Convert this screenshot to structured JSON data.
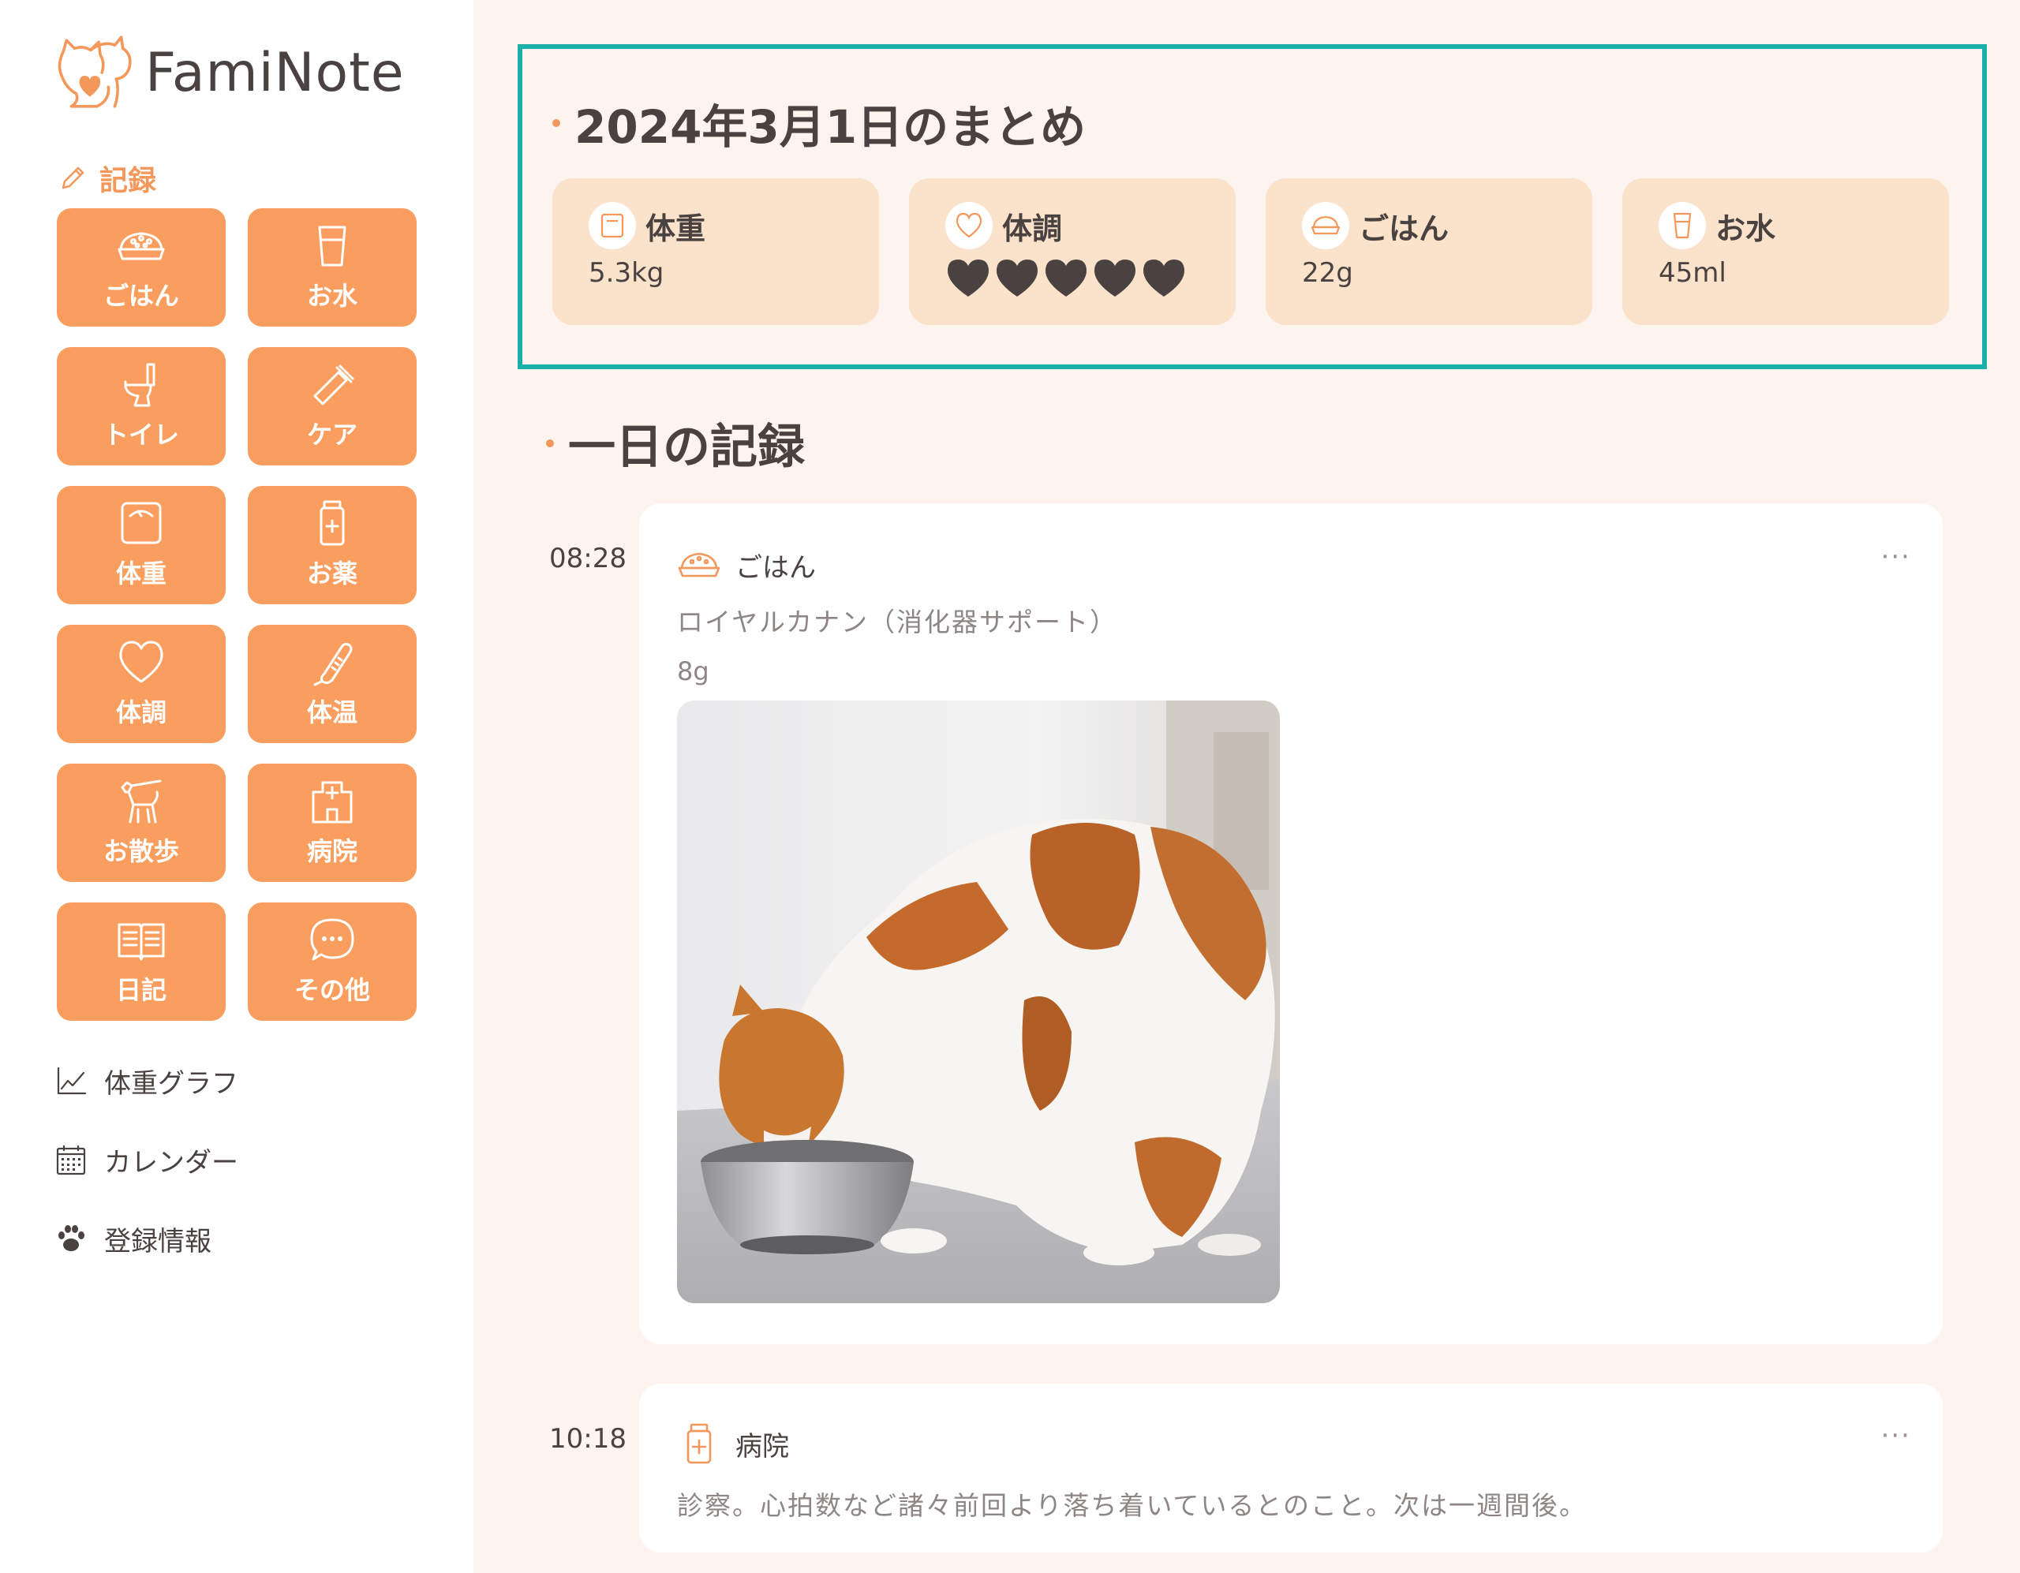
{
  "app": {
    "name": "FamiNote"
  },
  "sidebar": {
    "section_label": "記録",
    "tiles": [
      {
        "label": "ごはん",
        "icon": "food-bowl-icon"
      },
      {
        "label": "お水",
        "icon": "water-cup-icon"
      },
      {
        "label": "トイレ",
        "icon": "toilet-icon"
      },
      {
        "label": "ケア",
        "icon": "brush-icon"
      },
      {
        "label": "体重",
        "icon": "scale-icon"
      },
      {
        "label": "お薬",
        "icon": "medicine-bottle-icon"
      },
      {
        "label": "体調",
        "icon": "heart-icon"
      },
      {
        "label": "体温",
        "icon": "thermometer-icon"
      },
      {
        "label": "お散歩",
        "icon": "dog-walk-icon"
      },
      {
        "label": "病院",
        "icon": "hospital-icon"
      },
      {
        "label": "日記",
        "icon": "book-icon"
      },
      {
        "label": "その他",
        "icon": "chat-bubble-icon"
      }
    ],
    "nav": [
      {
        "label": "体重グラフ",
        "icon": "line-chart-icon"
      },
      {
        "label": "カレンダー",
        "icon": "calendar-icon"
      },
      {
        "label": "登録情報",
        "icon": "paw-icon"
      }
    ]
  },
  "summary": {
    "title": "2024年3月1日のまとめ",
    "cards": [
      {
        "title": "体重",
        "value": "5.3kg",
        "icon": "scale-icon"
      },
      {
        "title": "体調",
        "value": "",
        "hearts": 5,
        "icon": "heart-icon"
      },
      {
        "title": "ごはん",
        "value": "22g",
        "icon": "food-bowl-icon"
      },
      {
        "title": "お水",
        "value": "45ml",
        "icon": "water-cup-icon"
      }
    ]
  },
  "day": {
    "title": "一日の記録",
    "entries": [
      {
        "time": "08:28",
        "category": "ごはん",
        "icon": "food-bowl-icon",
        "description": "ロイヤルカナン（消化器サポート）",
        "amount": "8g",
        "has_photo": true,
        "more": "···"
      },
      {
        "time": "10:18",
        "category": "病院",
        "icon": "medicine-bottle-icon",
        "description": "診察。心拍数など諸々前回より落ち着いているとのこと。次は一週間後。",
        "more": "···"
      }
    ]
  },
  "colors": {
    "accent": "#f99e5e",
    "card": "#fae2cb",
    "highlight": "#1ab0a8",
    "background": "#fdf4ef"
  }
}
